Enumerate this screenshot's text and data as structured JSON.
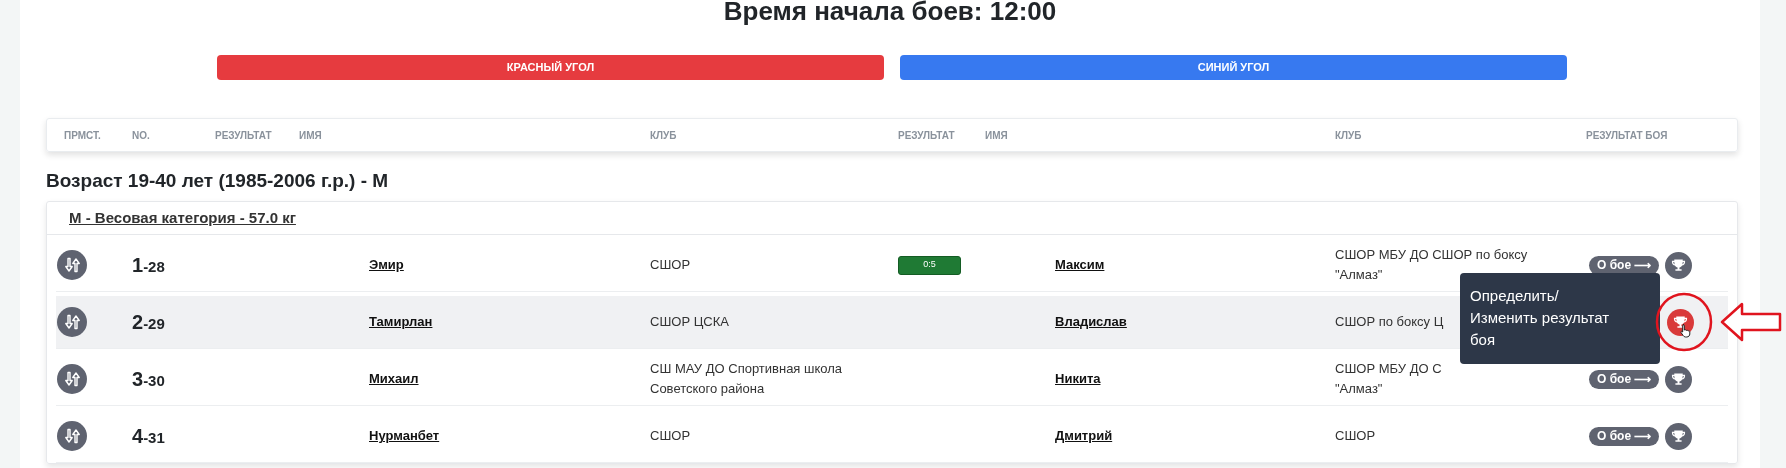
{
  "title": "Время начала боев: 12:00",
  "corners": [
    {
      "label": "КРАСНЫЙ УГОЛ",
      "color": "#e63b3f"
    },
    {
      "label": "СИНИЙ УГОЛ",
      "color": "#3779f0"
    }
  ],
  "columns": [
    "ПРМСТ.",
    "NO.",
    "РЕЗУЛЬТАТ",
    "ИМЯ",
    "КЛУБ",
    "РЕЗУЛЬТАТ",
    "ИМЯ",
    "КЛУБ",
    "РЕЗУЛЬТАТ БОЯ"
  ],
  "group": {
    "title": "Возраст 19-40 лет (1985-2006 г.р.) - М",
    "category": "М - Весовая категория - 57.0 кг",
    "bouts": [
      {
        "order": "1",
        "bout_no": "-28",
        "selected": false,
        "red": {
          "name": "Эмир",
          "club_lines": [
            "СШОР"
          ]
        },
        "blue": {
          "result": "0:5",
          "name": "Максим",
          "club_lines": [
            "СШОР МБУ ДО СШОР по боксу",
            "\"Алмаз\""
          ]
        },
        "info_button": "О бое ⟶",
        "trophy_highlighted": false
      },
      {
        "order": "2",
        "bout_no": "-29",
        "selected": true,
        "red": {
          "name": "Тамирлан",
          "club_lines": [
            "СШОР ЦСКА"
          ]
        },
        "blue": {
          "name": "Владислав",
          "club_lines": [
            "СШОР по боксу Ц"
          ]
        },
        "trophy_highlighted": true
      },
      {
        "order": "3",
        "bout_no": "-30",
        "selected": false,
        "red": {
          "name": "Михаил",
          "club_lines": [
            "СШ МАУ ДО Спортивная школа",
            "Советского района"
          ]
        },
        "blue": {
          "name": "Никита",
          "club_lines": [
            "СШОР МБУ ДО С",
            "\"Алмаз\""
          ]
        },
        "info_button": "О бое ⟶",
        "trophy_highlighted": false
      },
      {
        "order": "4",
        "bout_no": "-31",
        "selected": false,
        "red": {
          "name": "Нурманбет",
          "club_lines": [
            "СШОР"
          ]
        },
        "blue": {
          "name": "Дмитрий",
          "club_lines": [
            "СШОР"
          ]
        },
        "info_button": "О бое ⟶",
        "trophy_highlighted": false
      }
    ]
  },
  "tooltip_lines": [
    "Определить/",
    "Изменить результат",
    "боя"
  ],
  "annotation_marks": [
    {
      "kind": "ellipse"
    },
    {
      "kind": "arrow"
    },
    {
      "kind": "cursor"
    }
  ]
}
